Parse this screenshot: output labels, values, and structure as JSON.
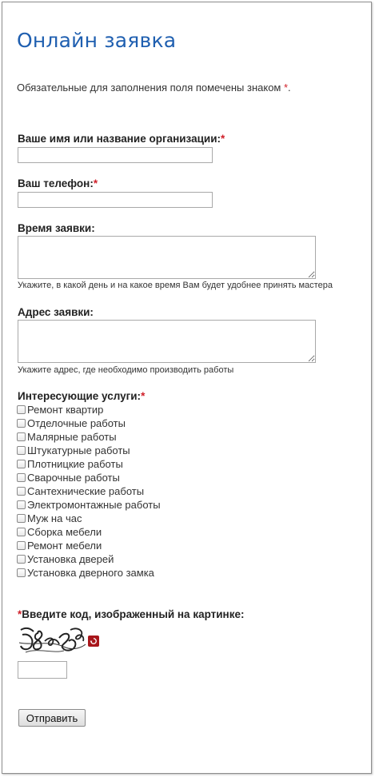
{
  "form": {
    "title": "Онлайн заявка",
    "required_note": "Обязательные для заполнения поля помечены знаком ",
    "required_mark": "*",
    "required_note_end": ".",
    "name_label": "Ваше имя или название организации:",
    "phone_label": "Ваш телефон:",
    "time_label": "Время заявки:",
    "time_hint": "Укажите, в какой день и на какое время Вам будет удобнее принять мастера",
    "address_label": "Адрес заявки:",
    "address_hint": "Укажите адрес, где необходимо производить работы",
    "services_label": "Интересующие услуги:",
    "services": [
      "Ремонт квартир",
      "Отделочные работы",
      "Малярные работы",
      "Штукатурные работы",
      "Плотницкие работы",
      "Сварочные работы",
      "Сантехнические работы",
      "Электромонтажные работы",
      "Муж на час",
      "Сборка мебели",
      "Ремонт мебели",
      "Установка дверей",
      "Установка дверного замка"
    ],
    "captcha_label": "Введите код, изображенный на картинке:",
    "captcha_text": "58 82",
    "submit_label": "Отправить"
  },
  "colors": {
    "title": "#1f5fb0",
    "required": "#d0202a",
    "refresh_button": "#a8161b"
  },
  "icons": {
    "refresh": "refresh-icon"
  }
}
